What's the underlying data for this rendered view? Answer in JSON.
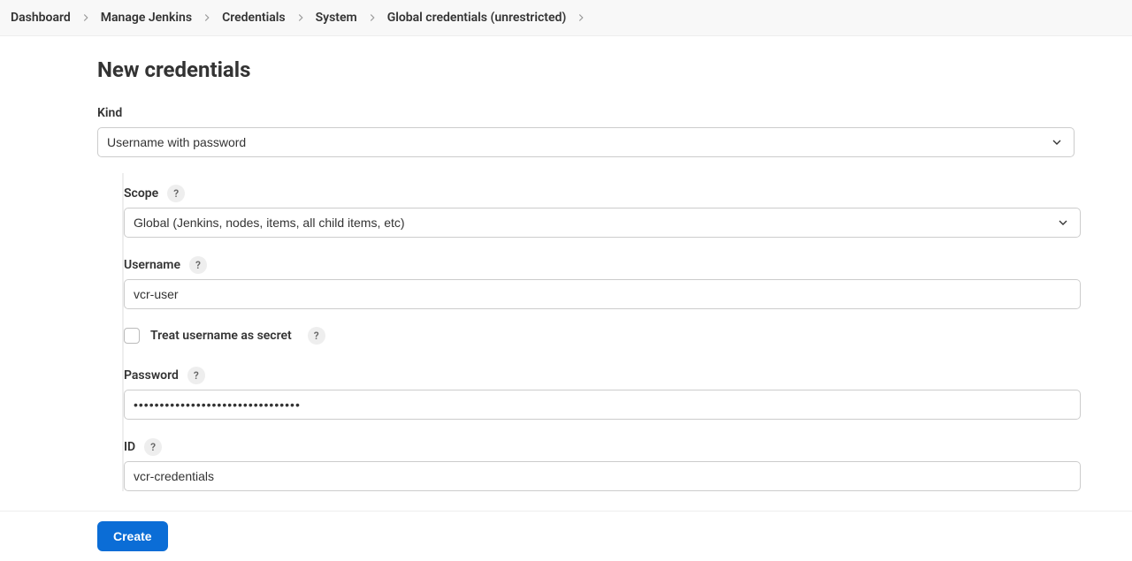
{
  "breadcrumb": [
    "Dashboard",
    "Manage Jenkins",
    "Credentials",
    "System",
    "Global credentials (unrestricted)"
  ],
  "page_title": "New credentials",
  "form": {
    "kind": {
      "label": "Kind",
      "value": "Username with password"
    },
    "scope": {
      "label": "Scope",
      "value": "Global (Jenkins, nodes, items, all child items, etc)"
    },
    "username": {
      "label": "Username",
      "value": "vcr-user"
    },
    "treat_secret": {
      "label": "Treat username as secret",
      "checked": false
    },
    "password": {
      "label": "Password",
      "value": "••••••••••••••••••••••••••••••••"
    },
    "id": {
      "label": "ID",
      "value": "vcr-credentials"
    }
  },
  "help_glyph": "?",
  "create_button": "Create"
}
